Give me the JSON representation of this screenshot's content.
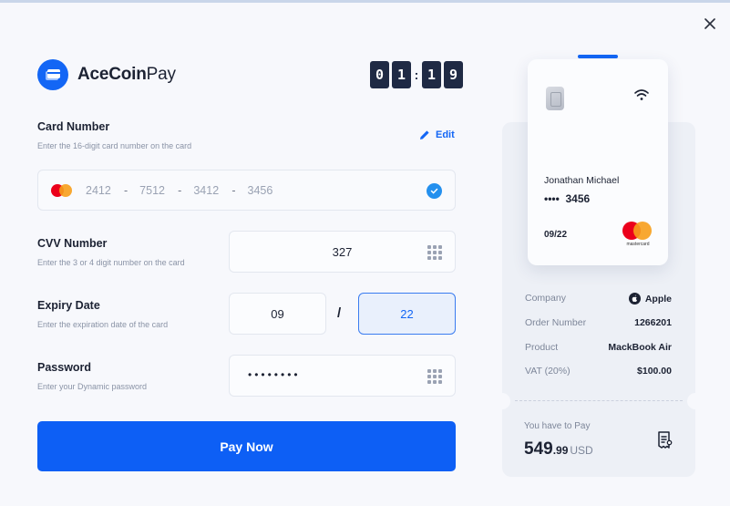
{
  "app": {
    "brand_bold": "AceCoin",
    "brand_light": "Pay",
    "timer_digits": [
      "0",
      "1",
      "1",
      "9"
    ]
  },
  "card_number": {
    "label": "Card Number",
    "help": "Enter the 16-digit card number on the card",
    "edit_label": "Edit",
    "segments": [
      "2412",
      "7512",
      "3412",
      "3456"
    ],
    "separator": "-"
  },
  "cvv": {
    "label": "CVV Number",
    "help": "Enter the 3 or 4 digit number on the card",
    "value": "327"
  },
  "expiry": {
    "label": "Expiry Date",
    "help": "Enter the expiration date of the card",
    "month": "09",
    "year": "22",
    "separator": "/"
  },
  "password": {
    "label": "Password",
    "help": "Enter your Dynamic password",
    "masked": "••••••••"
  },
  "pay_button": "Pay Now",
  "card_visual": {
    "holder": "Jonathan Michael",
    "masked_prefix": "••••",
    "last4": "3456",
    "expiry": "09/22",
    "brand_text": "mastercard"
  },
  "order": {
    "rows": [
      {
        "key": "Company",
        "value": "Apple"
      },
      {
        "key": "Order Number",
        "value": "1266201"
      },
      {
        "key": "Product",
        "value": "MackBook Air"
      },
      {
        "key": "VAT (20%)",
        "value": "$100.00"
      }
    ],
    "total_label": "You have to Pay",
    "total_whole": "549",
    "total_cents": ".99",
    "total_currency": "USD"
  },
  "colors": {
    "accent": "#0d5ff5",
    "dark": "#1f2a44",
    "mastercard_red": "#eb001b",
    "mastercard_orange": "#f79e1b"
  }
}
